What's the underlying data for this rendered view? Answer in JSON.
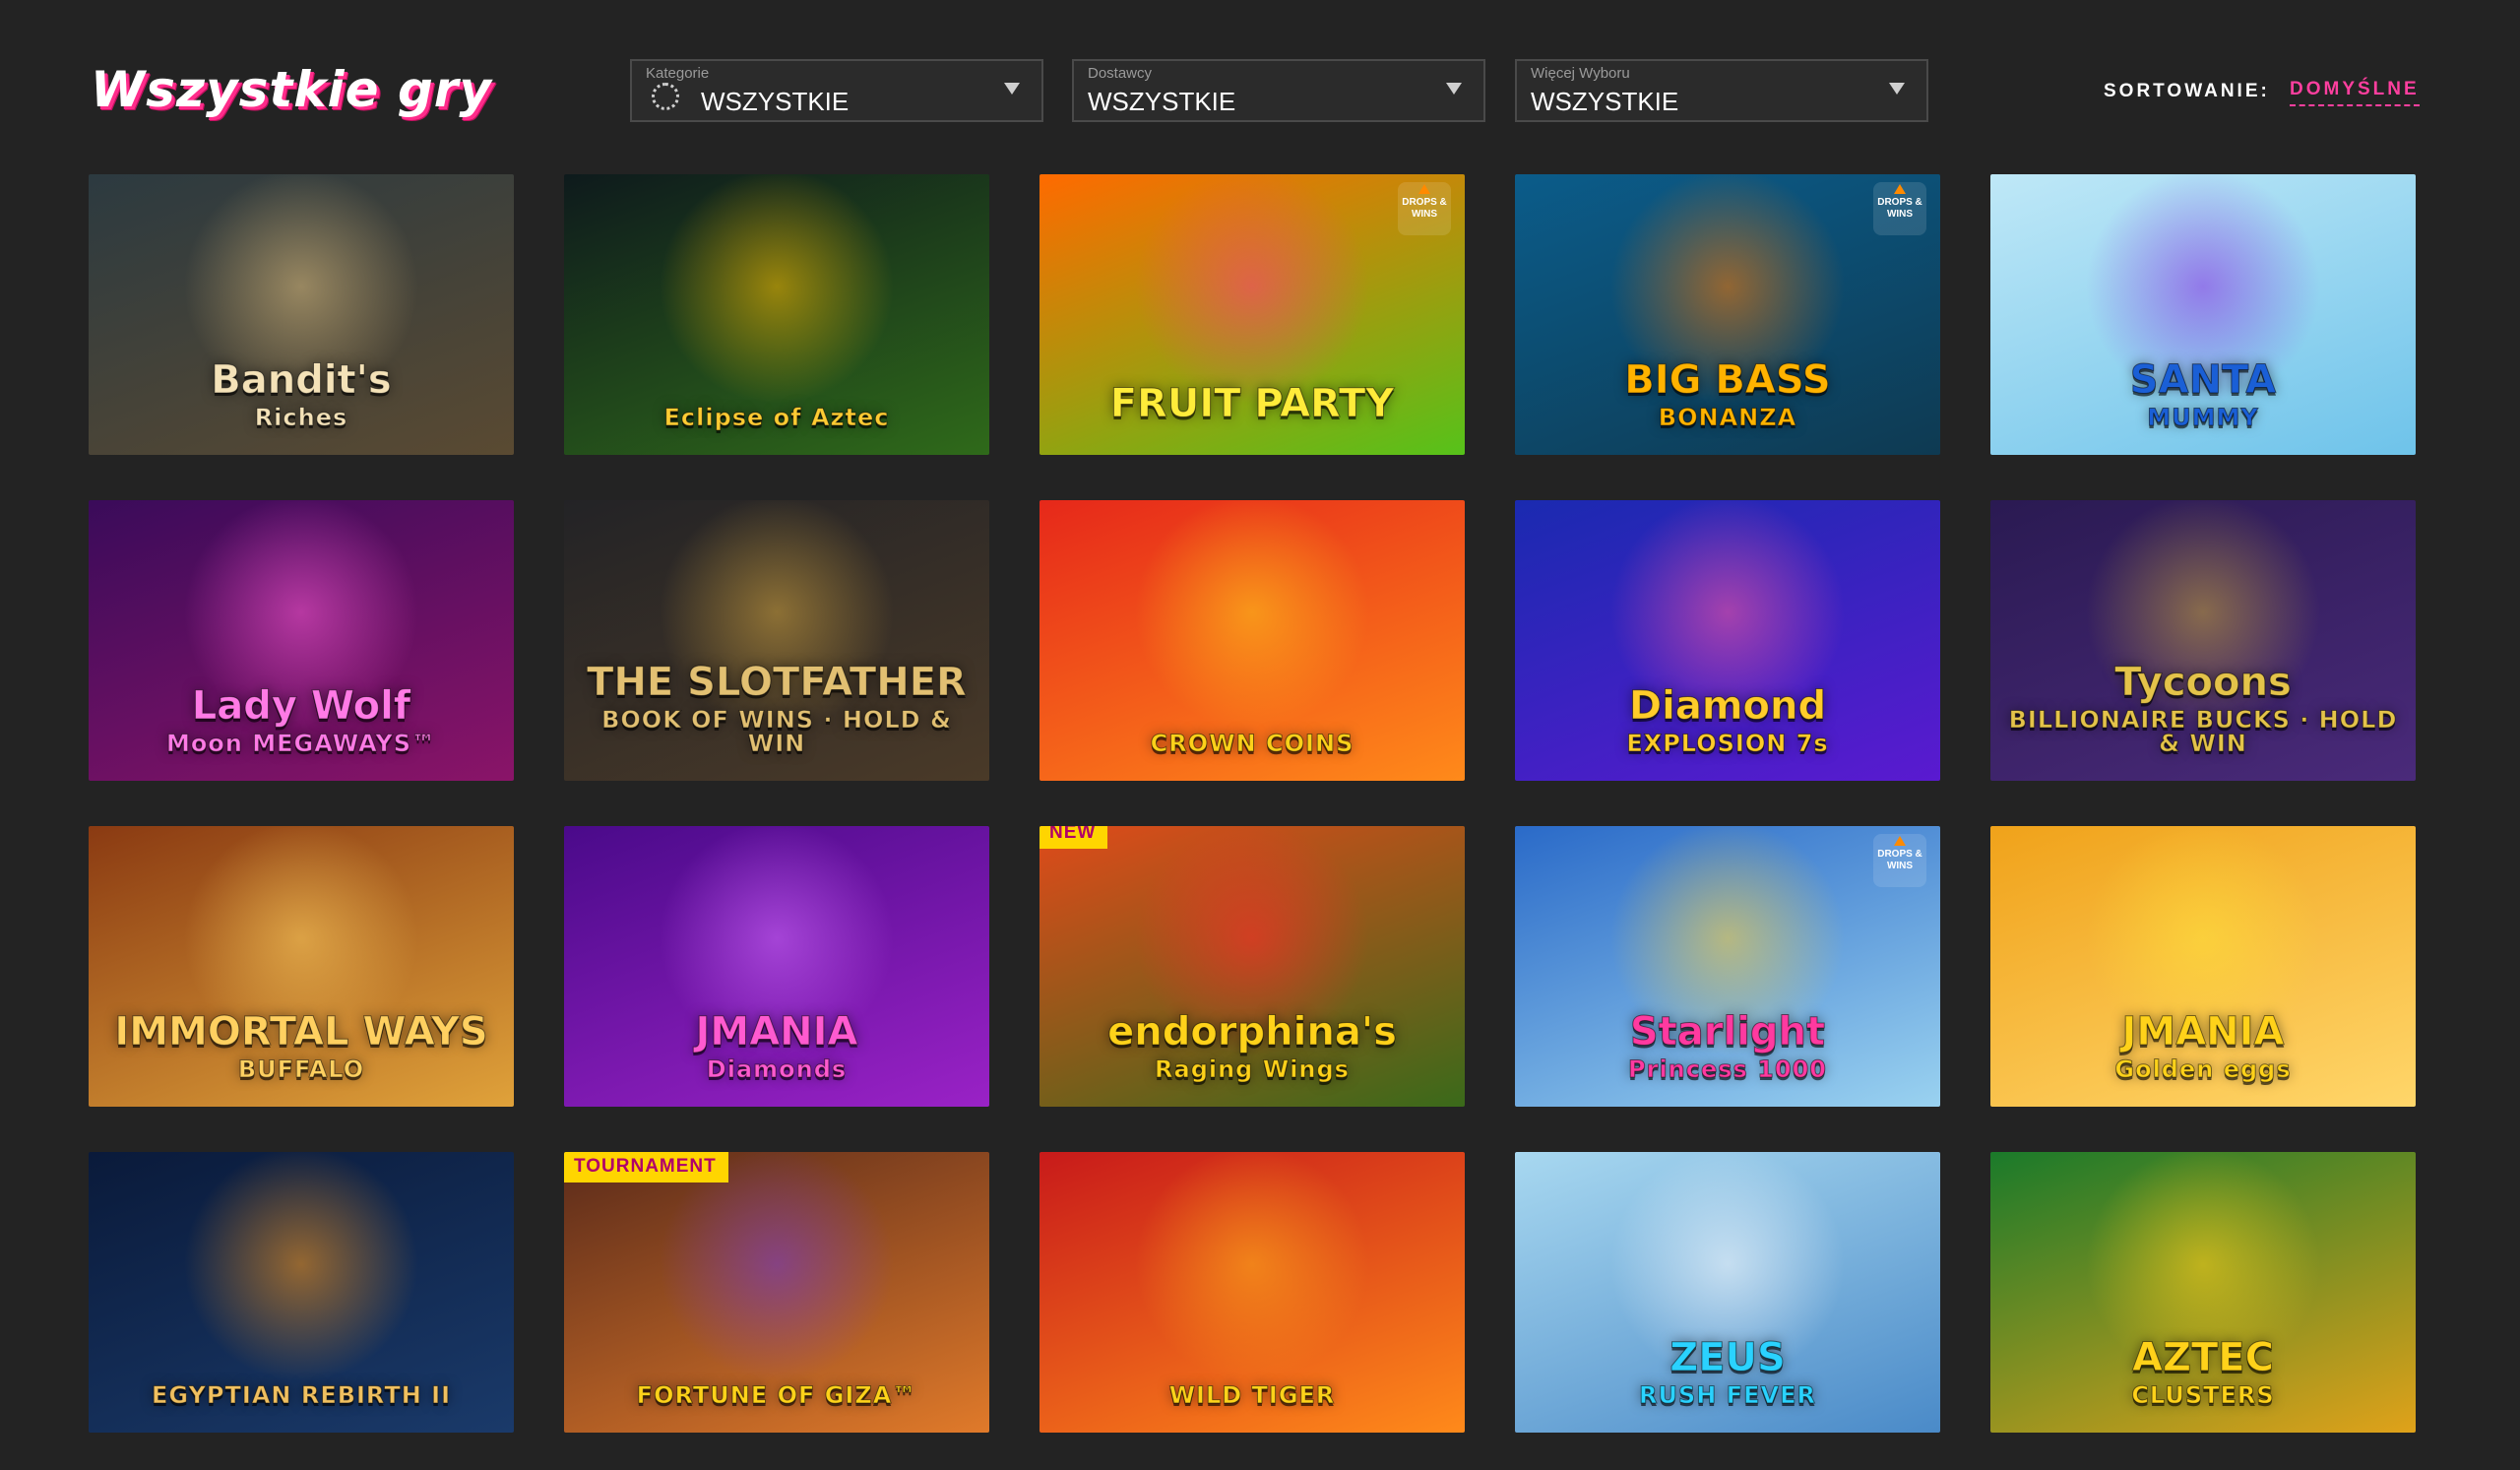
{
  "header": {
    "title": "Wszystkie gry",
    "filters": [
      {
        "label": "Kategorie",
        "value": "WSZYSTKIE",
        "icon": "category-icon"
      },
      {
        "label": "Dostawcy",
        "value": "WSZYSTKIE"
      },
      {
        "label": "Więcej Wyboru",
        "value": "WSZYSTKIE"
      }
    ],
    "sort_label": "SORTOWANIE:",
    "sort_value": "DOMYŚLNE"
  },
  "games": [
    {
      "title": "Bandit's",
      "subtitle": "Riches",
      "bg": [
        "#2c3a40",
        "#5a4a32"
      ],
      "accent": "#e0c080",
      "text": "#f4e2b8"
    },
    {
      "title": "",
      "subtitle": "Eclipse of Aztec",
      "bg": [
        "#0e1a1c",
        "#2f6a1a"
      ],
      "accent": "#ffc000",
      "text": "#ffcc33"
    },
    {
      "title": "FRUIT PARTY",
      "subtitle": "",
      "bg": [
        "#ff6a00",
        "#56c21a"
      ],
      "accent": "#ff3f7a",
      "text": "#ffec3a",
      "badge_icon": "drops-and-wins-icon",
      "badge_text": "DROPS & WINS"
    },
    {
      "title": "BIG BASS",
      "subtitle": "BONANZA",
      "bg": [
        "#0b5c8a",
        "#0e3a52"
      ],
      "accent": "#ff7a00",
      "text": "#ffb300",
      "badge_icon": "drops-and-wins-icon",
      "badge_text": "DROPS & WINS"
    },
    {
      "title": "SANTA",
      "subtitle": "MUMMY",
      "bg": [
        "#bfe8f7",
        "#6ec3ea"
      ],
      "accent": "#8a2de2",
      "text": "#1a5fd6"
    },
    {
      "title": "Lady Wolf",
      "subtitle": "Moon MEGAWAYS™",
      "bg": [
        "#3a0b5a",
        "#8a1468"
      ],
      "accent": "#ff5ad6",
      "text": "#ff7ae6"
    },
    {
      "title": "THE SLOTFATHER",
      "subtitle": "BOOK OF WINS · HOLD & WIN",
      "bg": [
        "#232326",
        "#4a3a28"
      ],
      "accent": "#d4a640",
      "text": "#e2c072"
    },
    {
      "title": "",
      "subtitle": "CROWN COINS",
      "bg": [
        "#e6281a",
        "#ff8a1a"
      ],
      "accent": "#ffcc1a",
      "text": "#ffd11a"
    },
    {
      "title": "Diamond",
      "subtitle": "EXPLOSION 7s",
      "bg": [
        "#1a2ab0",
        "#5a1ad0"
      ],
      "accent": "#ff5aa0",
      "text": "#ffcc2a"
    },
    {
      "title": "Tycoons",
      "subtitle": "BILLIONAIRE BUCKS · HOLD & WIN",
      "bg": [
        "#2a1a52",
        "#4a2a7a"
      ],
      "accent": "#c9a63a",
      "text": "#e4c34a"
    },
    {
      "title": "IMMORTAL WAYS",
      "subtitle": "BUFFALO",
      "bg": [
        "#8a3a12",
        "#e0a23a"
      ],
      "accent": "#ffd060",
      "text": "#ffd060"
    },
    {
      "title": "JMANIA",
      "subtitle": "Diamonds",
      "bg": [
        "#4a0a8a",
        "#9a22c6"
      ],
      "accent": "#d26aff",
      "text": "#ff5ad0"
    },
    {
      "title": "endorphina's",
      "subtitle": "Raging Wings",
      "bg": [
        "#e04a1a",
        "#3a6a1a"
      ],
      "accent": "#ff2a2a",
      "text": "#ffd21a",
      "badge": "NEW"
    },
    {
      "title": "Starlight",
      "subtitle": "Princess 1000",
      "bg": [
        "#2a6ac8",
        "#9ad2f0"
      ],
      "accent": "#ffd23a",
      "text": "#ff3aa0",
      "badge_icon": "drops-and-wins-icon",
      "badge_text": "DROPS & WINS"
    },
    {
      "title": "JMANIA",
      "subtitle": "Golden eggs",
      "bg": [
        "#f0a21a",
        "#ffd66a"
      ],
      "accent": "#ffe23a",
      "text": "#ffd21a"
    },
    {
      "title": "",
      "subtitle": "EGYPTIAN REBIRTH II",
      "bg": [
        "#0a1a3a",
        "#1a3a6a"
      ],
      "accent": "#ff9a1a",
      "text": "#f0c060"
    },
    {
      "title": "",
      "subtitle": "FORTUNE OF GIZA™",
      "bg": [
        "#5a2a1a",
        "#e07a2a"
      ],
      "accent": "#7a3ad0",
      "text": "#ffd21a",
      "badge": "TOURNAMENT"
    },
    {
      "title": "",
      "subtitle": "WILD TIGER",
      "bg": [
        "#c81a1a",
        "#ff8a1a"
      ],
      "accent": "#ffb01a",
      "text": "#ffd21a"
    },
    {
      "title": "ZEUS",
      "subtitle": "RUSH FEVER",
      "bg": [
        "#a8d8f0",
        "#4a8ac8"
      ],
      "accent": "#ffffff",
      "text": "#2ad2ff"
    },
    {
      "title": "AZTEC",
      "subtitle": "CLUSTERS",
      "bg": [
        "#1a7a2a",
        "#e0a21a"
      ],
      "accent": "#ffd21a",
      "text": "#ffd21a"
    }
  ]
}
